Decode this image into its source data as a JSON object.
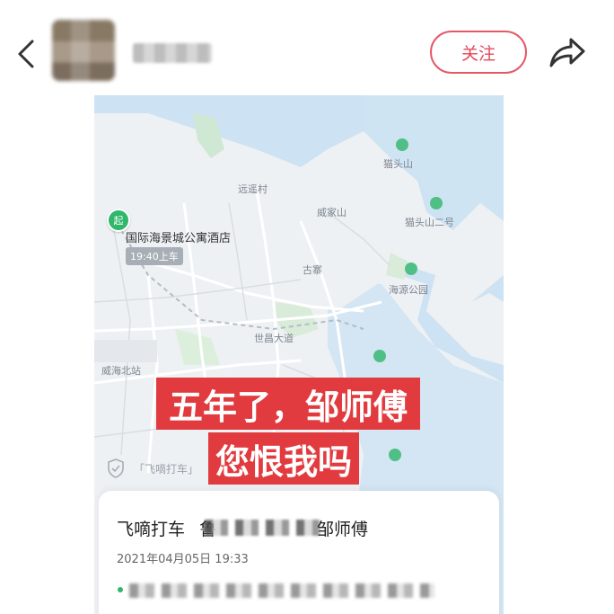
{
  "header": {
    "follow_label": "关注",
    "icons": [
      "back-icon",
      "share-icon"
    ]
  },
  "map": {
    "labels": [
      "猫头山",
      "远遥村",
      "威家山",
      "猫头山二号",
      "古寨",
      "海源公园",
      "世昌大道",
      "威海北站"
    ],
    "pickup": {
      "marker_char": "起",
      "poi_name": "国际海景城公寓酒店",
      "time_tag": "19:40上车"
    },
    "safety_label": "「飞嘀打车」"
  },
  "caption": {
    "line1": "五年了，邹师傅",
    "line2": "您恨我吗"
  },
  "trip": {
    "app_name": "飞嘀打车",
    "plate_prefix": "鲁",
    "driver": "邹师傅",
    "datetime": "2021年04月05日 19:33"
  },
  "colors": {
    "accent": "#e3485a",
    "caption_bg": "#e23b3f",
    "map_water": "#cde2f2",
    "map_land": "#eef1f4",
    "route_dot": "#2fb76a"
  }
}
